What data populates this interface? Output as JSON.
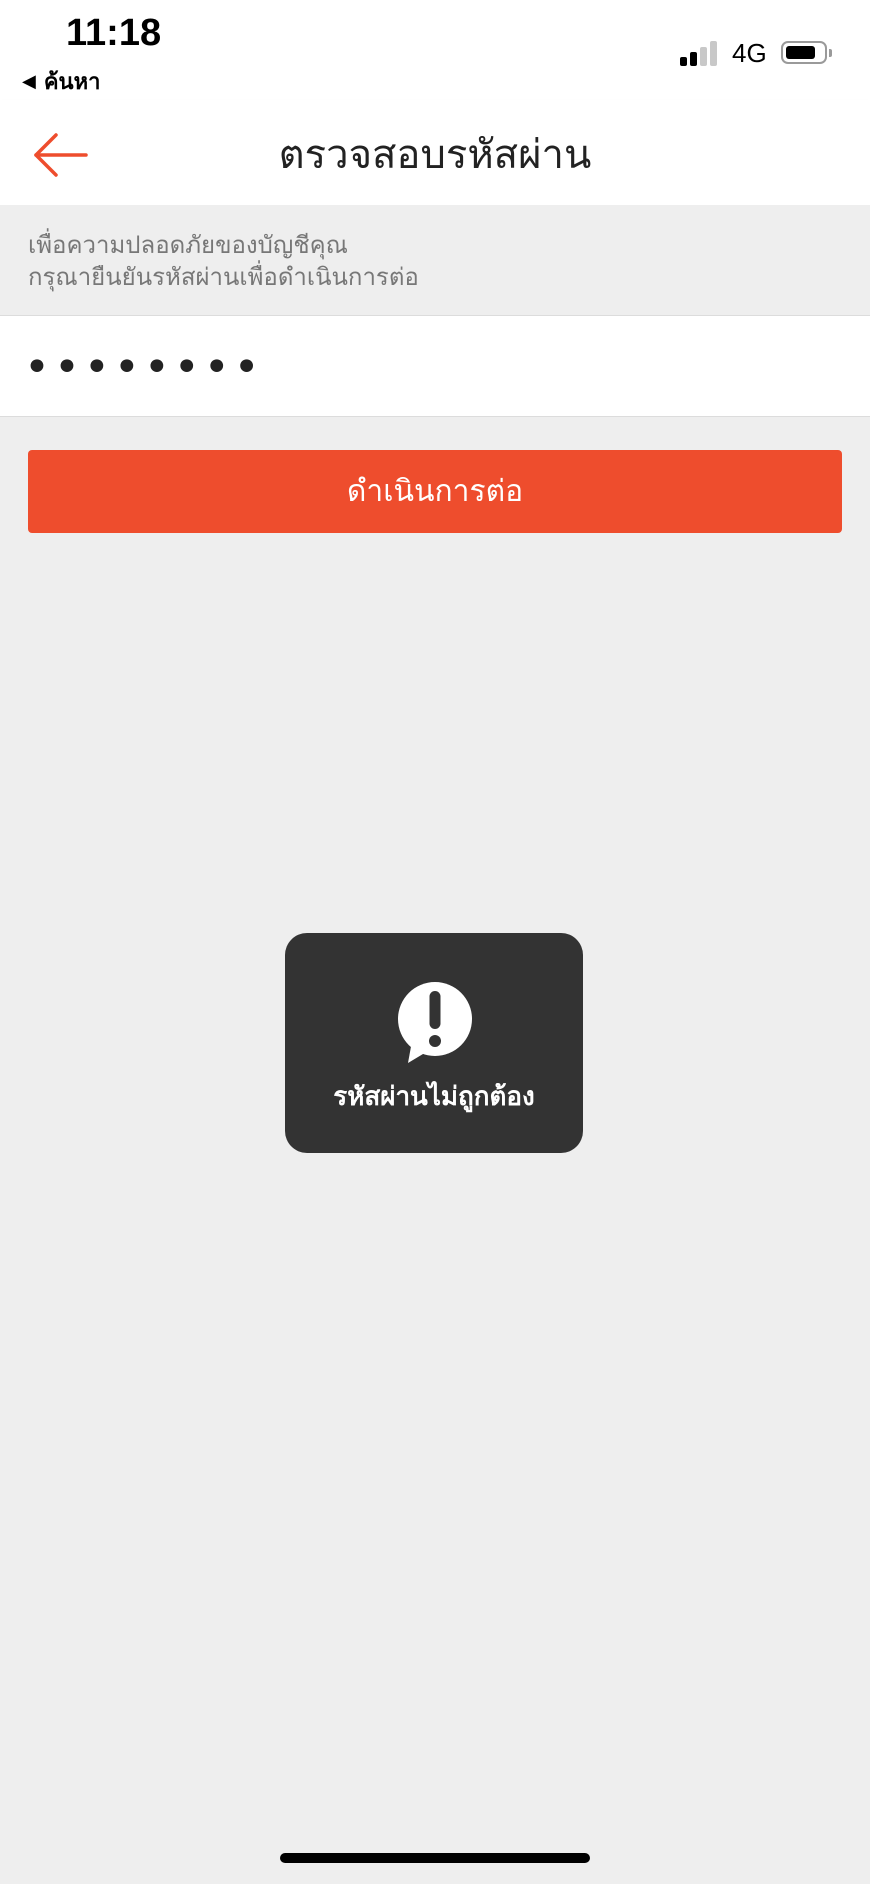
{
  "status_bar": {
    "time": "11:18",
    "back_app_label": "ค้นหา",
    "network": "4G",
    "signal_bars_active": 2,
    "signal_bars_total": 4
  },
  "nav": {
    "title": "ตรวจสอบรหัสผ่าน",
    "back_icon": "arrow-left-icon"
  },
  "info": {
    "line1": "เพื่อความปลอดภัยของบัญชีคุณ",
    "line2": "กรุณายืนยันรหัสผ่านเพื่อดำเนินการต่อ"
  },
  "password": {
    "value": "••••••••"
  },
  "continue_button": {
    "label": "ดำเนินการต่อ"
  },
  "toast": {
    "icon": "exclamation-bubble-icon",
    "message": "รหัสผ่านไม่ถูกต้อง"
  },
  "colors": {
    "accent": "#ee4d2d",
    "background": "#eeeeee",
    "toast_bg": "#333333"
  }
}
